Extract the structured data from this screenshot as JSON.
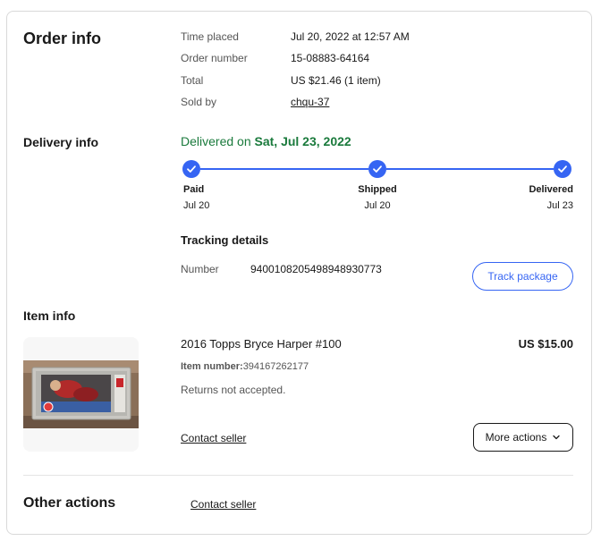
{
  "order": {
    "title": "Order info",
    "time_label": "Time placed",
    "time_value": "Jul 20, 2022 at 12:57 AM",
    "number_label": "Order number",
    "number_value": "15-08883-64164",
    "total_label": "Total",
    "total_value": "US $21.46 (1 item)",
    "sold_label": "Sold by",
    "sold_value": "chqu-37"
  },
  "delivery": {
    "title": "Delivery info",
    "status_prefix": "Delivered on ",
    "status_date": "Sat, Jul 23, 2022",
    "steps": [
      {
        "name": "Paid",
        "date": "Jul 20"
      },
      {
        "name": "Shipped",
        "date": "Jul 20"
      },
      {
        "name": "Delivered",
        "date": "Jul 23"
      }
    ],
    "tracking_title": "Tracking details",
    "tracking_label": "Number",
    "tracking_number": "9400108205498948930773",
    "track_button": "Track package",
    "accent_color": "#3665f3",
    "success_color": "#1a7a3c"
  },
  "item": {
    "title": "Item info",
    "name": "2016 Topps Bryce Harper #100",
    "price": "US $15.00",
    "item_number_label": "Item number:",
    "item_number_value": "394167262177",
    "returns": "Returns not accepted.",
    "contact": "Contact seller",
    "more_actions": "More actions"
  },
  "other": {
    "title": "Other actions",
    "contact": "Contact seller"
  }
}
